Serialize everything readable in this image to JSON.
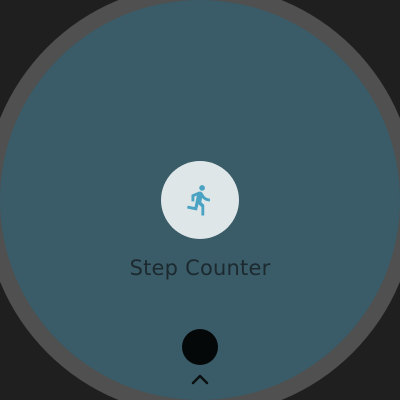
{
  "app": {
    "label": "Step Counter",
    "icon": "directions-run-icon",
    "icon_color": "#4aa3c3",
    "button_color": "#dfe6e8"
  },
  "colors": {
    "face": "#3a5b68",
    "bezel": "#505050",
    "background": "#1f1f1f",
    "label_text": "#1c2a30"
  },
  "navigation": {
    "chevron_icon": "chevron-up-icon"
  }
}
